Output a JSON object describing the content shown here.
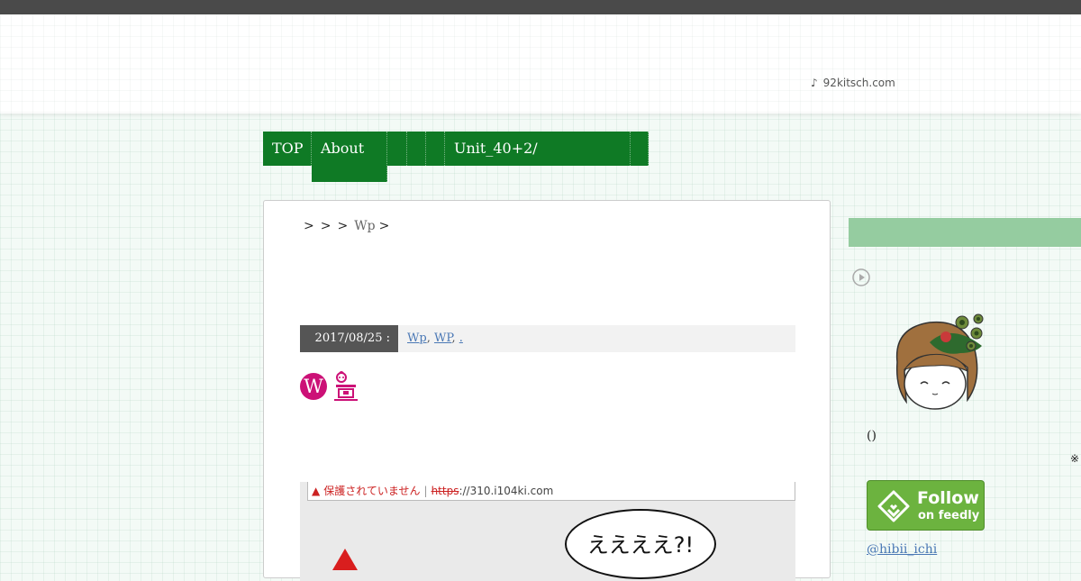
{
  "header": {
    "site_note_icon": "music-note-icon",
    "site_note": "♪",
    "site_link": "92kitsch.com"
  },
  "nav": {
    "items": [
      "TOP",
      "About",
      "",
      "",
      "",
      "Unit_40+2/",
      ""
    ]
  },
  "breadcrumb": {
    "separators": [
      ">",
      ">",
      ">",
      ">"
    ],
    "current": "Wp"
  },
  "post_meta": {
    "date": "2017/08/25 :",
    "tags": [
      "Wp",
      "WP",
      "."
    ],
    "tag_separator": ","
  },
  "post": {
    "wp_icon_letter": "W",
    "screenshot": {
      "warning_text": "保護されていません",
      "url_divider": "|",
      "url_scheme": "https",
      "url_rest": "://310.i104ki.com",
      "bubble_text": "ええええ?!"
    }
  },
  "sidebar": {
    "play_icon": "play-circle-icon",
    "paren": "()",
    "asterisk": "※",
    "feedly": {
      "line1": "Follow",
      "line2": "on feedly"
    },
    "twitter": "@hibii_ichi"
  },
  "colors": {
    "nav_green": "#0f7a25",
    "sidebar_band": "#95cca0",
    "feedly_green": "#6cb33f",
    "link": "#4a78b5",
    "wp_magenta": "#cc1177"
  }
}
